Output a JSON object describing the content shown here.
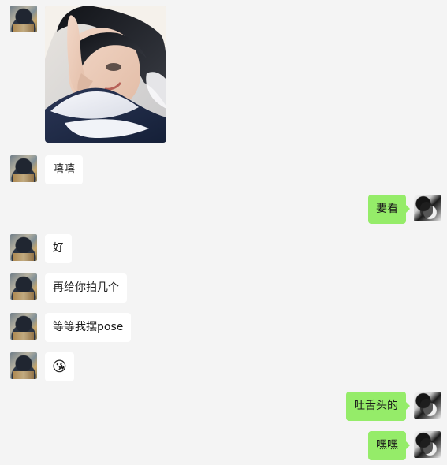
{
  "messages": [
    {
      "kind": "image",
      "side": "left"
    },
    {
      "kind": "text",
      "side": "left",
      "text": "嘻嘻"
    },
    {
      "kind": "text",
      "side": "right",
      "text": "要看"
    },
    {
      "kind": "text",
      "side": "left",
      "text": "好"
    },
    {
      "kind": "text",
      "side": "left",
      "text": "再给你拍几个"
    },
    {
      "kind": "text",
      "side": "left",
      "text": "等等我摆pose"
    },
    {
      "kind": "emoji",
      "side": "left",
      "text": "😘"
    },
    {
      "kind": "text",
      "side": "right",
      "text": "吐舌头的"
    },
    {
      "kind": "text",
      "side": "right",
      "text": "嘿嘿"
    }
  ]
}
